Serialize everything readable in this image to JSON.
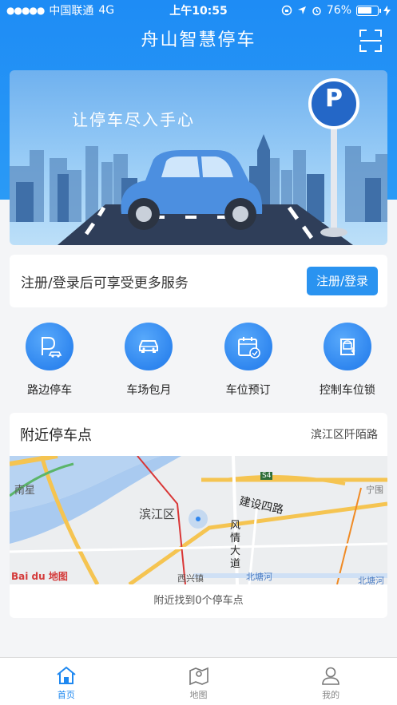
{
  "status_bar": {
    "signal": "●●●●●",
    "carrier": "中国联通",
    "network": "4G",
    "time": "上午10:55",
    "battery_percent": "76%",
    "battery_level": 0.76
  },
  "nav": {
    "title": "舟山智慧停车",
    "scan_icon": "scan-icon"
  },
  "banner": {
    "slogan": "让停车尽入手心",
    "sign_letter": "P"
  },
  "login": {
    "prompt": "注册/登录后可享受更多服务",
    "button_label": "注册/登录"
  },
  "quick_actions": [
    {
      "label": "路边停车",
      "icon": "roadside-parking-icon"
    },
    {
      "label": "车场包月",
      "icon": "car-icon"
    },
    {
      "label": "车位预订",
      "icon": "calendar-check-icon"
    },
    {
      "label": "控制车位锁",
      "icon": "parking-lock-icon"
    }
  ],
  "nearby": {
    "title": "附近停车点",
    "location": "滨江区阡陌路",
    "result_text": "附近找到0个停车点",
    "map_labels": {
      "nanxing": "南星",
      "binjiang": "滨江区",
      "jianshe_road": "建设四路",
      "fengqing": "风情大道",
      "xixing": "西兴镇",
      "beitang": "北塘河",
      "s4": "S4",
      "ningwei": "宁围",
      "beitang_right": "北塘河",
      "map_logo": "Bai du 地图"
    }
  },
  "tabbar": {
    "items": [
      {
        "label": "首页",
        "icon": "home-icon",
        "active": true
      },
      {
        "label": "地图",
        "icon": "map-icon",
        "active": false
      },
      {
        "label": "我的",
        "icon": "user-icon",
        "active": false
      }
    ]
  },
  "colors": {
    "primary": "#1e8cf5",
    "button": "#2a93f0",
    "tab_active": "#1e88f0"
  }
}
